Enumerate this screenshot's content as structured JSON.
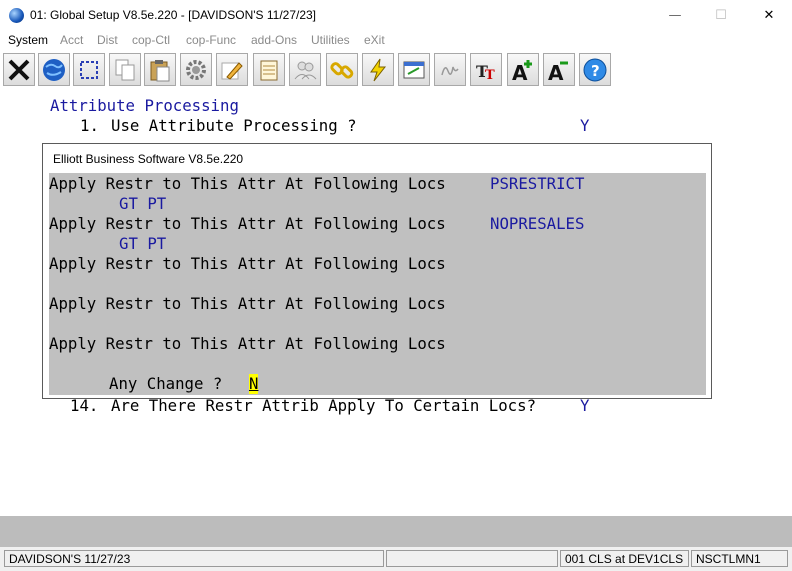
{
  "window": {
    "title": "01: Global Setup V8.5e.220 - [DAVIDSON'S 11/27/23]",
    "minimize_glyph": "—",
    "maximize_glyph": "☐",
    "close_glyph": "✕"
  },
  "menu": {
    "items": [
      "System",
      "Acct",
      "Dist",
      "cop-Ctl",
      "cop-Func",
      "add-Ons",
      "Utilities",
      "eXit"
    ]
  },
  "toolbar": {
    "icons": [
      "close-x-icon",
      "globe-icon",
      "select-box-icon",
      "copy-icon",
      "paste-icon",
      "settings-gear-icon",
      "edit-pencil-icon",
      "notepad-icon",
      "users-icon",
      "link-chain-icon",
      "lightning-icon",
      "document-edit-icon",
      "signature-icon",
      "font-type-icon",
      "font-increase-icon",
      "font-decrease-icon",
      "help-icon"
    ]
  },
  "screen": {
    "heading": "Attribute Processing",
    "line1_num": "1.",
    "line1_text": "Use Attribute Processing ?",
    "line1_value": "Y",
    "line14_num": "14.",
    "line14_text": "Are There Restr Attrib Apply To Certain Locs?",
    "line14_value": "Y"
  },
  "dialog": {
    "title": "Elliott Business Software V8.5e.220",
    "rows": [
      {
        "label": "Apply Restr to This Attr At Following Locs",
        "value": "PSRESTRICT",
        "locs": "GT PT"
      },
      {
        "label": "Apply Restr to This Attr At Following Locs",
        "value": "NOPRESALES",
        "locs": "GT PT"
      },
      {
        "label": "Apply Restr to This Attr At Following Locs",
        "value": "",
        "locs": ""
      },
      {
        "label": "Apply Restr to This Attr At Following Locs",
        "value": "",
        "locs": ""
      },
      {
        "label": "Apply Restr to This Attr At Following Locs",
        "value": "",
        "locs": ""
      }
    ],
    "prompt": "Any Change ?",
    "prompt_value": "N"
  },
  "status": {
    "company": "DAVIDSON'S 11/27/23",
    "cell2": "",
    "location": "001 CLS at DEV1CLS",
    "terminal": "NSCTLMN1"
  }
}
